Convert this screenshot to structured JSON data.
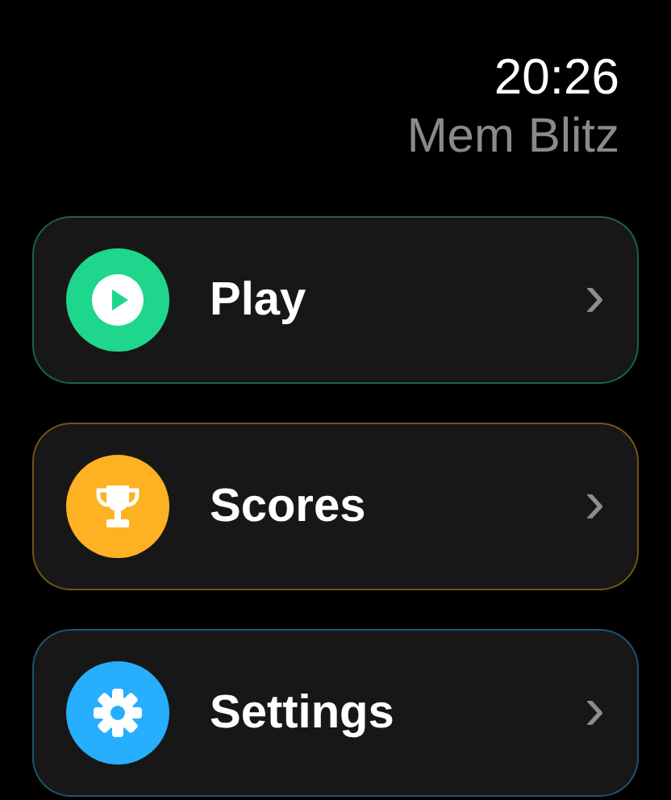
{
  "status_bar": {
    "time": "20:26"
  },
  "app_title": "Mem Blitz",
  "menu": [
    {
      "label": "Play",
      "kind": "play",
      "color": "#1ed68c",
      "chevron": "›"
    },
    {
      "label": "Scores",
      "kind": "trophy",
      "color": "#ffb124",
      "chevron": "›"
    },
    {
      "label": "Settings",
      "kind": "gear",
      "color": "#27aefc",
      "chevron": "›"
    }
  ]
}
